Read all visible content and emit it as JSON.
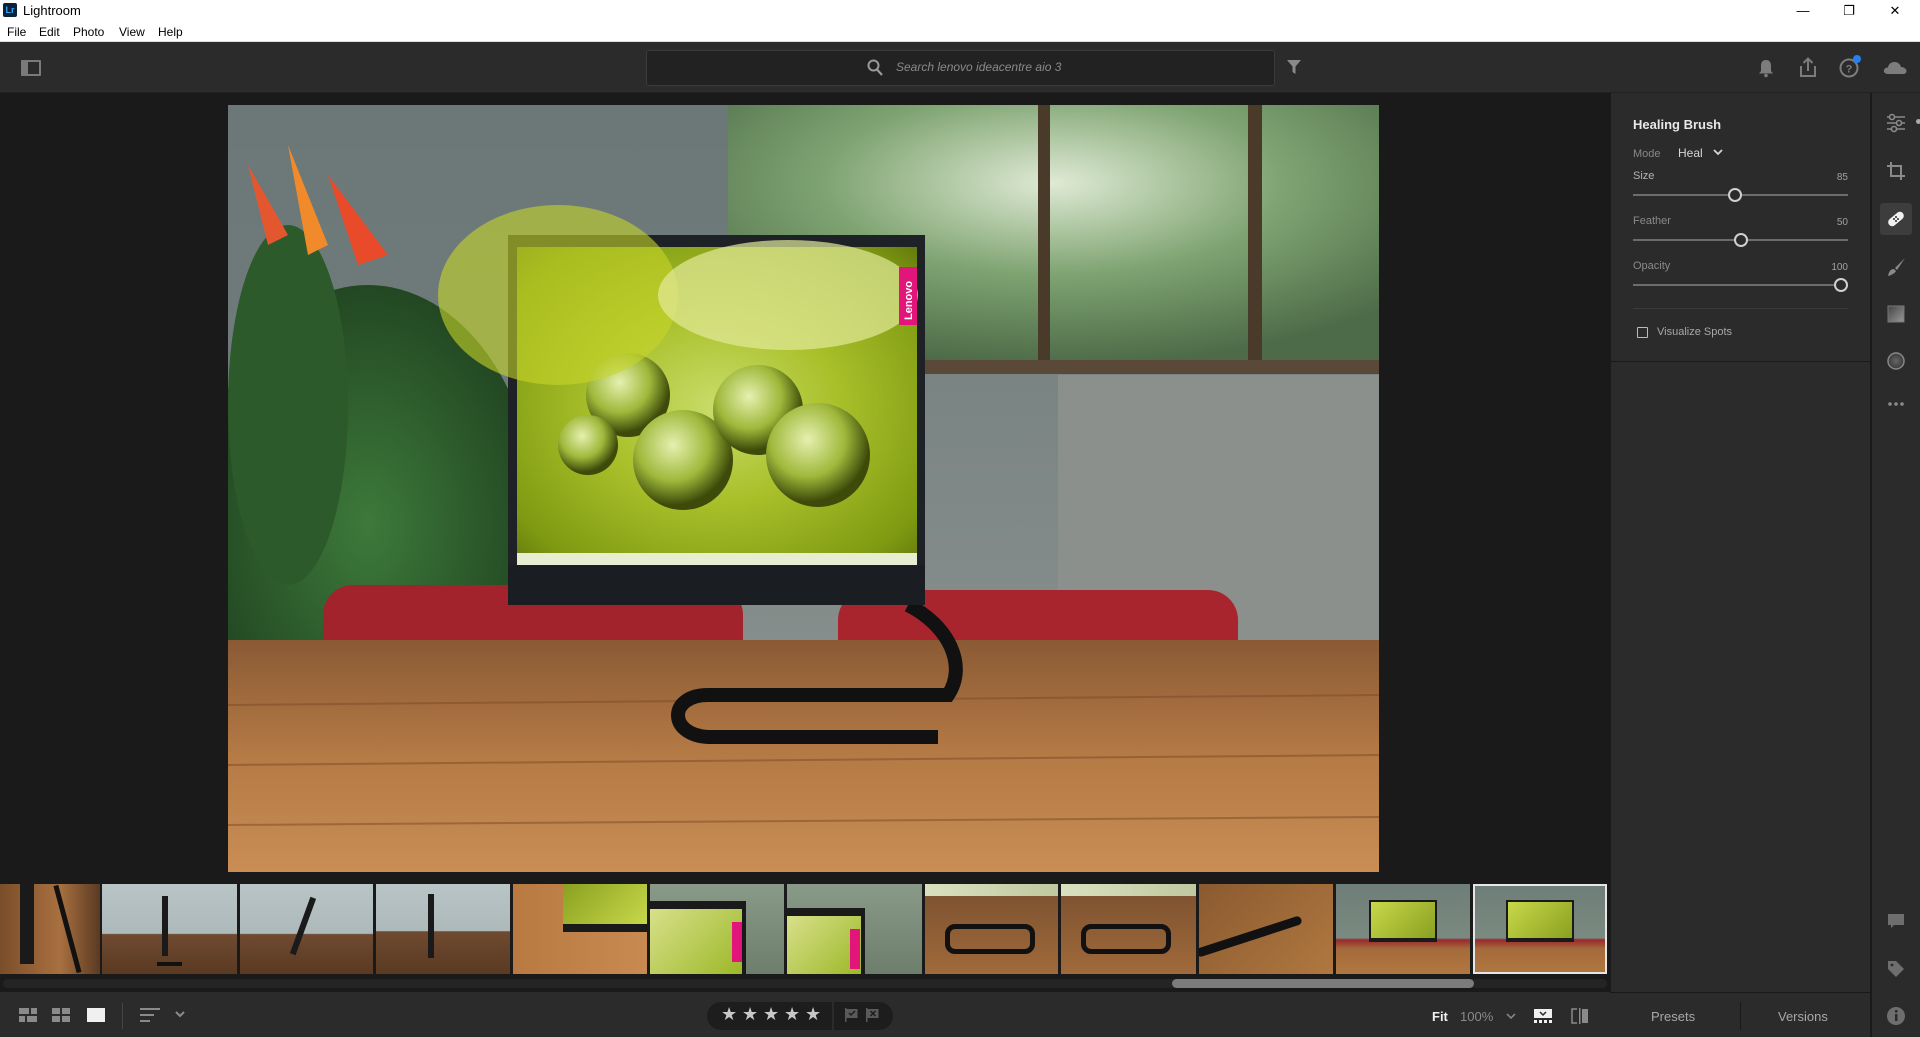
{
  "window": {
    "app_icon_text": "Lr",
    "title": "Lightroom",
    "controls": {
      "minimize": "—",
      "restore": "❐",
      "close": "✕"
    }
  },
  "menu": [
    {
      "label": "File"
    },
    {
      "label": "Edit"
    },
    {
      "label": "Photo"
    },
    {
      "label": "View"
    },
    {
      "label": "Help"
    }
  ],
  "toolbar": {
    "search_placeholder": "Search lenovo ideacentre aio 3",
    "icons": [
      "panel-toggle-icon",
      "search-icon",
      "filter-icon",
      "bell-icon",
      "share-icon",
      "help-icon",
      "cloud-icon"
    ],
    "help_has_notification": true
  },
  "photo": {
    "subject": "Lenovo IdeaCentre AIO 3 on wooden table",
    "screen_brand": "Lenovo"
  },
  "filmstrip": {
    "thumbnails": [
      {
        "desc": "stand closeup",
        "selected": false
      },
      {
        "desc": "side view upright",
        "selected": false
      },
      {
        "desc": "side view tilted",
        "selected": false
      },
      {
        "desc": "side view upright 2",
        "selected": false
      },
      {
        "desc": "corner on wood",
        "selected": false
      },
      {
        "desc": "lenovo logo corner",
        "selected": false
      },
      {
        "desc": "lenovo logo corner 2",
        "selected": false
      },
      {
        "desc": "stand base",
        "selected": false
      },
      {
        "desc": "stand base 2",
        "selected": false
      },
      {
        "desc": "stand bar",
        "selected": false
      },
      {
        "desc": "front view",
        "selected": false
      },
      {
        "desc": "front view edited",
        "selected": true
      }
    ],
    "scroll_position": 0.73
  },
  "bottombar": {
    "view_modes": [
      "square-grid-icon",
      "photo-grid-icon",
      "detail-view-icon"
    ],
    "sort_icon": "sort-icon",
    "rating": {
      "stars": 5,
      "filled": 0
    },
    "flags": [
      "pick-flag-icon",
      "reject-flag-icon"
    ],
    "fit_label": "Fit",
    "zoom_value": "100%",
    "filmstrip_toggle": "filmstrip-icon",
    "compare_icon": "compare-icon"
  },
  "healing_panel": {
    "title": "Healing Brush",
    "mode_label": "Mode",
    "mode_value": "Heal",
    "sliders": [
      {
        "label": "Size",
        "value": "85",
        "fraction": 0.48
      },
      {
        "label": "Feather",
        "value": "50",
        "fraction": 0.5
      },
      {
        "label": "Opacity",
        "value": "100",
        "fraction": 1.0
      }
    ],
    "visualize_spots_label": "Visualize Spots",
    "visualize_spots_checked": false
  },
  "tool_rail": {
    "tools": [
      "edit-sliders-icon",
      "crop-icon",
      "healing-icon",
      "brush-icon",
      "linear-gradient-icon",
      "radial-gradient-icon",
      "more-icon"
    ],
    "active": "healing-icon",
    "bottom": [
      "comment-icon",
      "tag-icon",
      "info-icon"
    ]
  },
  "panel_tabs": [
    {
      "label": "Presets"
    },
    {
      "label": "Versions"
    }
  ],
  "colors": {
    "chrome_dark": "#2b2b2b",
    "canvas": "#1a1a1a",
    "accent_blue": "#2680eb",
    "lenovo_pink": "#e2157a"
  }
}
